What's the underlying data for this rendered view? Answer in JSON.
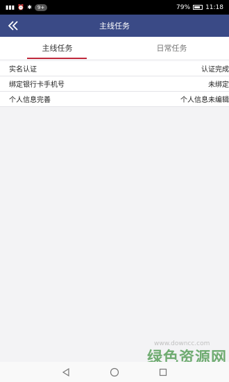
{
  "status_bar": {
    "signal": "4G",
    "notification_badge": "9+",
    "battery_percent": "79%",
    "time": "11:18"
  },
  "header": {
    "title": "主线任务",
    "back_icon": "double-chevron-left-icon"
  },
  "tabs": [
    {
      "label": "主线任务",
      "active": true
    },
    {
      "label": "日常任务",
      "active": false
    }
  ],
  "tasks": [
    {
      "name": "实名认证",
      "status": "认证完成"
    },
    {
      "name": "绑定银行卡手机号",
      "status": "未绑定"
    },
    {
      "name": "个人信息完善",
      "status": "个人信息未编辑"
    }
  ],
  "watermark": {
    "text": "绿色资源网",
    "url": "www.downcc.com"
  },
  "colors": {
    "header_bg": "#3a4a86",
    "tab_underline": "#c0293b",
    "watermark": "#5aa05c"
  }
}
